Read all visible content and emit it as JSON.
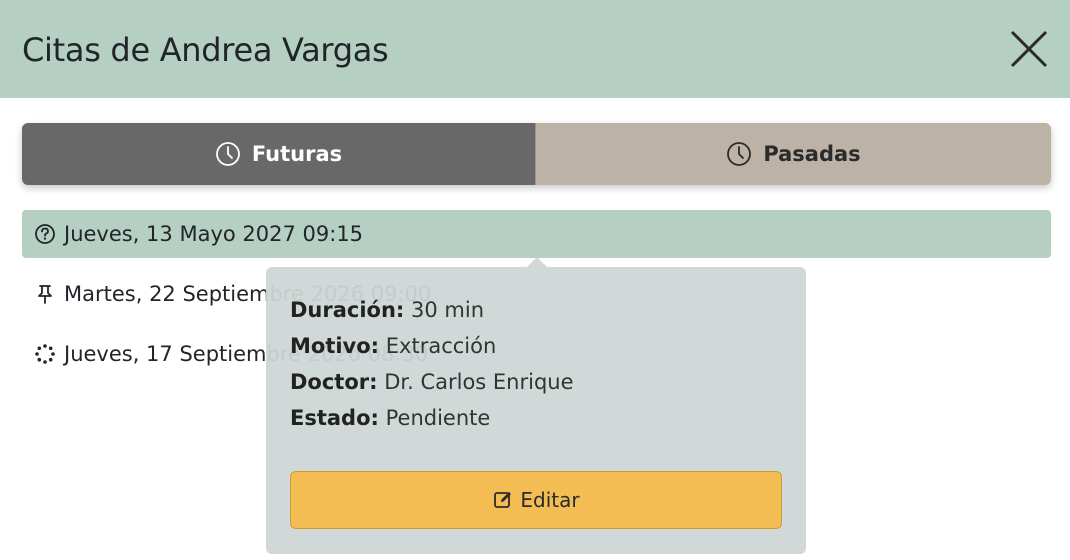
{
  "header": {
    "title": "Citas de Andrea Vargas",
    "close_icon": "close-icon"
  },
  "tabs": [
    {
      "label": "Futuras",
      "icon": "clock-icon",
      "active": true
    },
    {
      "label": "Pasadas",
      "icon": "clock-icon",
      "active": false
    }
  ],
  "appointments": [
    {
      "label": "Jueves, 13 Mayo 2027 09:15",
      "icon": "question-circle-icon",
      "selected": true
    },
    {
      "label": "Martes, 22 Septiembre 2026 09:00",
      "icon": "pin-icon",
      "selected": false
    },
    {
      "label": "Jueves, 17 Septiembre 2026 08:30",
      "icon": "loading-dots-icon",
      "selected": false
    }
  ],
  "popover": {
    "duration_label": "Duración:",
    "duration_value": "30 min",
    "reason_label": "Motivo:",
    "reason_value": "Extracción",
    "doctor_label": "Doctor:",
    "doctor_value": "Dr. Carlos Enrique",
    "status_label": "Estado:",
    "status_value": "Pendiente",
    "edit_label": "Editar",
    "edit_icon": "edit-icon"
  },
  "colors": {
    "header_bg": "#b5cfc3",
    "tab_active_bg": "#686868",
    "tab_inactive_bg": "#bcb2a6",
    "selected_row_bg": "#b5cfc3",
    "popover_bg": "#cdd7d6",
    "edit_button_bg": "#f3bd53"
  }
}
